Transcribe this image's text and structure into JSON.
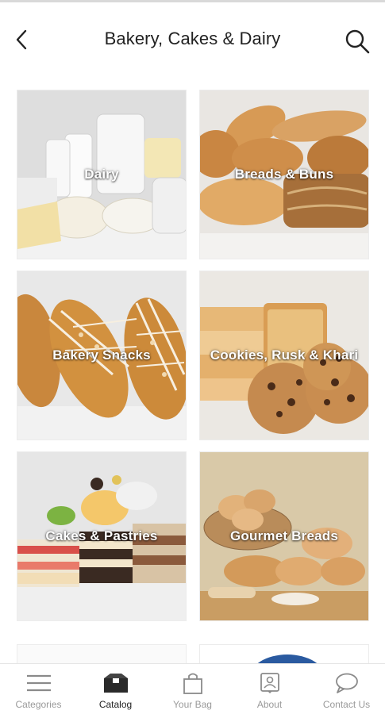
{
  "header": {
    "title": "Bakery, Cakes & Dairy",
    "back_icon": "chevron-left-icon",
    "search_icon": "search-icon"
  },
  "tiles": [
    {
      "label": "Dairy",
      "art": "dairy"
    },
    {
      "label": "Breads & Buns",
      "art": "breads"
    },
    {
      "label": "Bakery Snacks",
      "art": "snacks"
    },
    {
      "label": "Cookies, Rusk & Khari",
      "art": "cookies"
    },
    {
      "label": "Cakes & Pastries",
      "art": "cakes"
    },
    {
      "label": "Gourmet Breads",
      "art": "gourmet"
    }
  ],
  "bottom_nav": {
    "items": [
      {
        "label": "Categories",
        "icon": "menu-icon",
        "active": false
      },
      {
        "label": "Catalog",
        "icon": "catalog-icon",
        "active": true
      },
      {
        "label": "Your Bag",
        "icon": "bag-icon",
        "active": false
      },
      {
        "label": "About",
        "icon": "about-icon",
        "active": false
      },
      {
        "label": "Contact Us",
        "icon": "chat-icon",
        "active": false
      }
    ]
  },
  "colors": {
    "active_text": "#222222",
    "inactive_text": "#9a9a9a",
    "title_text": "#222222"
  }
}
